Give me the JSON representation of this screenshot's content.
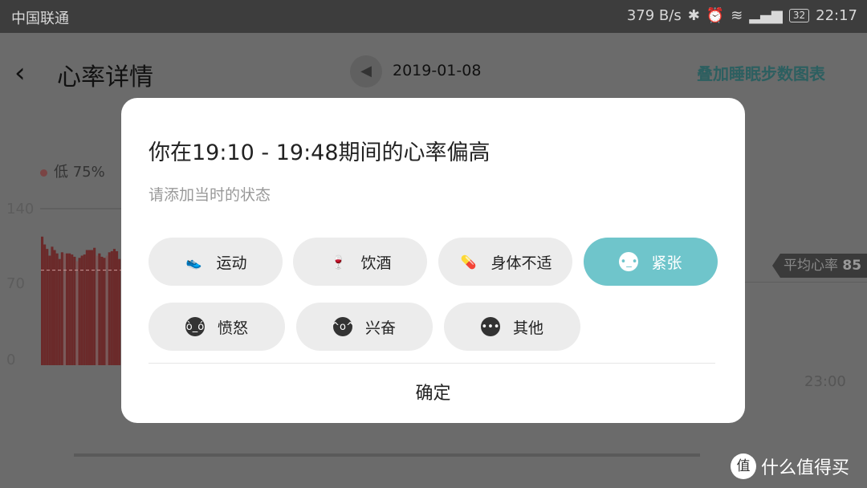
{
  "status_bar": {
    "carrier": "中国联通",
    "speed": "379 B/s",
    "battery": "32",
    "time": "22:17"
  },
  "header": {
    "back_icon": "chevron-left",
    "title": "心率详情",
    "date": "2019-01-08",
    "overlay_link": "叠加睡眠步数图表"
  },
  "chart_data": {
    "type": "bar",
    "legend": "低 75%",
    "y_ticks": [
      "140",
      "70",
      "0"
    ],
    "ylim": [
      0,
      140
    ],
    "x_tick": "23:00",
    "average_label": "平均心率",
    "average_value": "85",
    "bar_color": "#6b2a2a",
    "values": [
      115,
      108,
      104,
      98,
      106,
      103,
      100,
      95,
      101,
      100,
      100,
      100,
      99,
      97,
      93,
      96,
      98,
      99,
      103,
      103,
      103,
      105,
      98,
      100,
      97,
      96,
      98,
      101,
      102,
      104,
      102,
      95
    ]
  },
  "dialog": {
    "title": "你在19:10 - 19:48期间的心率偏高",
    "subtitle": "请添加当时的状态",
    "options": [
      {
        "label": "运动",
        "icon": "sneaker",
        "selected": false
      },
      {
        "label": "饮酒",
        "icon": "wine-glass",
        "selected": false
      },
      {
        "label": "身体不适",
        "icon": "pill",
        "selected": false
      },
      {
        "label": "紧张",
        "icon": "nervous-face",
        "selected": true
      },
      {
        "label": "愤怒",
        "icon": "angry-face",
        "selected": false
      },
      {
        "label": "兴奋",
        "icon": "excited-face",
        "selected": false
      },
      {
        "label": "其他",
        "icon": "more-dots",
        "selected": false
      }
    ],
    "confirm": "确定",
    "accent": "#6fc5cb"
  },
  "watermark": {
    "badge": "值",
    "text": "什么值得买"
  }
}
